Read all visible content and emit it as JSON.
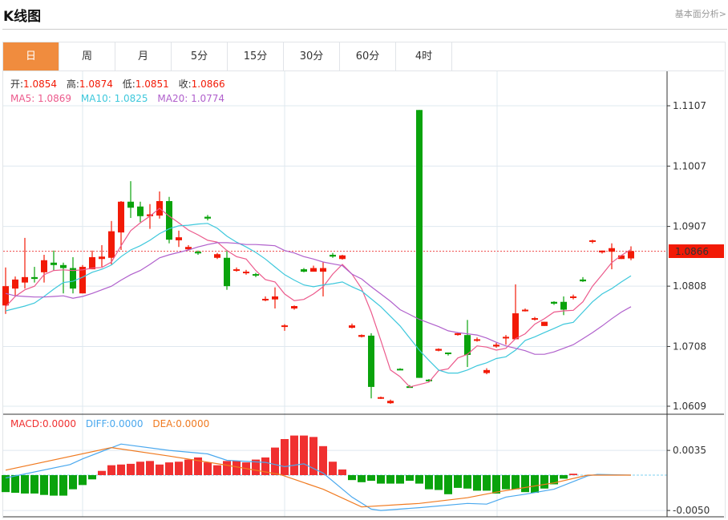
{
  "header": {
    "title": "K线图",
    "more_link": "基本面分析>"
  },
  "tabs": [
    {
      "label": "日",
      "active": true
    },
    {
      "label": "周"
    },
    {
      "label": "月"
    },
    {
      "label": "5分"
    },
    {
      "label": "15分"
    },
    {
      "label": "30分"
    },
    {
      "label": "60分"
    },
    {
      "label": "4时"
    }
  ],
  "colors": {
    "up": "#f21a06",
    "down": "#0aa30c",
    "ma5": "#ec5a8c",
    "ma10": "#3ec8dc",
    "ma20": "#b060cc",
    "macd": "#f03030",
    "diff": "#4aa8ee",
    "dea": "#f07a20",
    "accent": "#f08c3e"
  },
  "chart_data": [
    {
      "type": "candlestick",
      "ohlc_legend": {
        "open_label": "开:",
        "open": "1.0854",
        "high_label": "高:",
        "high": "1.0874",
        "low_label": "低:",
        "low": "1.0851",
        "close_label": "收:",
        "close": "1.0866"
      },
      "ma_legend": {
        "ma5": "MA5: 1.0869",
        "ma10": "MA10: 1.0825",
        "ma20": "MA20: 1.0774"
      },
      "current_price": "1.0866",
      "y_ticks": [
        "1.1107",
        "1.1007",
        "1.0907",
        "1.0808",
        "1.0708",
        "1.0609"
      ],
      "ylim": [
        1.0609,
        1.1107
      ],
      "ohlc": [
        [
          1.0776,
          1.0839,
          1.0762,
          1.0808
        ],
        [
          1.0804,
          1.0824,
          1.0791,
          1.0819
        ],
        [
          1.0814,
          1.0888,
          1.0804,
          1.0823
        ],
        [
          1.0823,
          1.084,
          1.0814,
          1.082
        ],
        [
          1.0831,
          1.086,
          1.0814,
          1.0851
        ],
        [
          1.0847,
          1.0867,
          1.0834,
          1.0843
        ],
        [
          1.0843,
          1.0847,
          1.0796,
          1.0838
        ],
        [
          1.0838,
          1.0856,
          1.0796,
          1.0804
        ],
        [
          1.0796,
          1.0843,
          1.0796,
          1.084
        ],
        [
          1.0836,
          1.0867,
          1.0836,
          1.0856
        ],
        [
          1.0853,
          1.0876,
          1.084,
          1.0857
        ],
        [
          1.0855,
          1.0916,
          1.0844,
          1.0899
        ],
        [
          1.0897,
          1.0949,
          1.0868,
          1.0948
        ],
        [
          1.0948,
          1.0982,
          1.0921,
          1.0938
        ],
        [
          1.094,
          1.0948,
          1.0914,
          1.0924
        ],
        [
          1.0924,
          1.0944,
          1.0903,
          1.0927
        ],
        [
          1.0925,
          1.0965,
          1.092,
          1.0949
        ],
        [
          1.0949,
          1.0956,
          1.0879,
          1.0885
        ],
        [
          1.0884,
          1.09,
          1.0873,
          1.0889
        ],
        [
          1.0869,
          1.0876,
          1.0867,
          1.0873
        ],
        [
          1.0865,
          1.0867,
          1.086,
          1.0863
        ],
        [
          1.0923,
          1.0926,
          1.0917,
          1.092
        ],
        [
          1.0855,
          1.0863,
          1.0853,
          1.0861
        ],
        [
          1.0855,
          1.0868,
          1.0802,
          1.0808
        ],
        [
          1.0835,
          1.0839,
          1.0832,
          1.0836
        ],
        [
          1.083,
          1.0835,
          1.0827,
          1.0832
        ],
        [
          1.0828,
          1.083,
          1.0823,
          1.0827
        ],
        [
          1.0786,
          1.0791,
          1.0783,
          1.0787
        ],
        [
          1.0786,
          1.0806,
          1.0771,
          1.0791
        ],
        [
          1.0742,
          1.0745,
          1.0734,
          1.0743
        ],
        [
          1.0771,
          1.0776,
          1.0769,
          1.0775
        ],
        [
          1.0836,
          1.0838,
          1.0831,
          1.0832
        ],
        [
          1.0832,
          1.0842,
          1.0832,
          1.0838
        ],
        [
          1.0832,
          1.0848,
          1.0791,
          1.0838
        ],
        [
          1.086,
          1.0863,
          1.0855,
          1.0857
        ],
        [
          1.0853,
          1.086,
          1.0852,
          1.0859
        ],
        [
          1.0739,
          1.0746,
          1.0738,
          1.0743
        ],
        [
          1.0724,
          1.0728,
          1.0723,
          1.0727
        ],
        [
          1.0726,
          1.073,
          1.0622,
          1.0641
        ],
        [
          1.0622,
          1.0625,
          1.0621,
          1.0624
        ],
        [
          1.0614,
          1.062,
          1.0613,
          1.0618
        ],
        [
          1.0671,
          1.0672,
          1.0669,
          1.067
        ],
        [
          1.0642,
          1.0644,
          1.064,
          1.0641
        ],
        [
          1.11,
          1.11,
          1.0656,
          1.0656
        ],
        [
          1.0653,
          1.0654,
          1.0649,
          1.0651
        ],
        [
          1.0701,
          1.0705,
          1.07,
          1.0704
        ],
        [
          1.0698,
          1.0698,
          1.0693,
          1.0696
        ],
        [
          1.0727,
          1.0731,
          1.0726,
          1.073
        ],
        [
          1.0727,
          1.0752,
          1.0674,
          1.0694
        ],
        [
          1.0718,
          1.0723,
          1.0716,
          1.072
        ],
        [
          1.0664,
          1.0672,
          1.0662,
          1.0669
        ],
        [
          1.0708,
          1.0714,
          1.0706,
          1.0711
        ],
        [
          1.0722,
          1.0727,
          1.0711,
          1.0724
        ],
        [
          1.072,
          1.0811,
          1.072,
          1.0763
        ],
        [
          1.0767,
          1.0771,
          1.0766,
          1.0769
        ],
        [
          1.0753,
          1.0757,
          1.0751,
          1.0755
        ],
        [
          1.0742,
          1.0749,
          1.0742,
          1.0749
        ],
        [
          1.0782,
          1.0783,
          1.0777,
          1.0779
        ],
        [
          1.0782,
          1.0791,
          1.076,
          1.0769
        ],
        [
          1.079,
          1.0794,
          1.0786,
          1.0791
        ],
        [
          1.0819,
          1.0823,
          1.0815,
          1.0816
        ],
        [
          1.0883,
          1.0885,
          1.0879,
          1.0884
        ],
        [
          1.0864,
          1.0867,
          1.0862,
          1.0867
        ],
        [
          1.0865,
          1.0879,
          1.0836,
          1.0871
        ],
        [
          1.0853,
          1.0859,
          1.0853,
          1.0859
        ],
        [
          1.0854,
          1.0874,
          1.0851,
          1.0866
        ]
      ],
      "ma5": [
        1.0774,
        1.0791,
        1.0802,
        1.0808,
        1.0827,
        1.0834,
        1.0835,
        1.0834,
        1.0835,
        1.0838,
        1.0839,
        1.0848,
        1.0875,
        1.09,
        1.0913,
        1.0924,
        1.0937,
        1.0924,
        1.0913,
        1.0901,
        1.0893,
        1.0884,
        1.0881,
        1.0867,
        1.0857,
        1.0853,
        1.0834,
        1.0819,
        1.0815,
        1.0795,
        1.0784,
        1.0786,
        1.0795,
        1.0807,
        1.0828,
        1.0844,
        1.0828,
        1.0804,
        1.0765,
        1.0718,
        1.0669,
        1.0658,
        1.0641,
        1.0645,
        1.0649,
        1.0668,
        1.0671,
        1.0689,
        1.0695,
        1.0709,
        1.0707,
        1.0702,
        1.0705,
        1.0721,
        1.0729,
        1.0745,
        1.0754,
        1.0765,
        1.0767,
        1.0768,
        1.0782,
        1.0808,
        1.0827,
        1.0847,
        1.0859,
        1.0869
      ],
      "ma10": [
        1.0767,
        1.0771,
        1.0775,
        1.078,
        1.0791,
        1.0803,
        1.0814,
        1.0816,
        1.0823,
        1.0831,
        1.0836,
        1.0843,
        1.0857,
        1.0868,
        1.0875,
        1.0884,
        1.0895,
        1.0903,
        1.0908,
        1.0909,
        1.0911,
        1.0912,
        1.0904,
        1.0891,
        1.0881,
        1.0873,
        1.0864,
        1.0853,
        1.084,
        1.0827,
        1.0818,
        1.081,
        1.0807,
        1.081,
        1.0812,
        1.0815,
        1.0807,
        1.08,
        1.0787,
        1.0774,
        1.0758,
        1.0742,
        1.0722,
        1.0702,
        1.0685,
        1.0669,
        1.0664,
        1.0664,
        1.0669,
        1.0676,
        1.0681,
        1.0688,
        1.0691,
        1.0702,
        1.0718,
        1.0724,
        1.0731,
        1.0738,
        1.0745,
        1.0748,
        1.0765,
        1.0782,
        1.0795,
        1.0804,
        1.0815,
        1.0825
      ],
      "ma20": [
        1.0796,
        1.0792,
        1.0791,
        1.079,
        1.079,
        1.0791,
        1.0792,
        1.0788,
        1.0791,
        1.0796,
        1.0802,
        1.0808,
        1.0818,
        1.0827,
        1.0834,
        1.0844,
        1.0855,
        1.086,
        1.0864,
        1.0868,
        1.0873,
        1.0877,
        1.088,
        1.088,
        1.0879,
        1.0877,
        1.0877,
        1.0876,
        1.0875,
        1.0867,
        1.0863,
        1.0857,
        1.0853,
        1.0848,
        1.0845,
        1.0842,
        1.0828,
        1.082,
        1.0807,
        1.0795,
        1.0783,
        1.0769,
        1.0761,
        1.0753,
        1.0747,
        1.0741,
        1.0734,
        1.0731,
        1.0729,
        1.0727,
        1.0722,
        1.0715,
        1.0709,
        1.0705,
        1.0701,
        1.0695,
        1.0695,
        1.0699,
        1.0705,
        1.0711,
        1.0721,
        1.0731,
        1.0742,
        1.0754,
        1.0765,
        1.0774
      ]
    },
    {
      "type": "bar+line",
      "legend": {
        "macd": "MACD:0.0000",
        "diff": "DIFF:0.0000",
        "dea": "DEA:0.0000"
      },
      "y_ticks": [
        "0.0035",
        "-0.0050"
      ],
      "ylim": [
        -0.0052,
        0.006
      ],
      "macd": [
        -0.0024,
        -0.0025,
        -0.0026,
        -0.0026,
        -0.0028,
        -0.0029,
        -0.0029,
        -0.002,
        -0.0014,
        -0.0006,
        0.0006,
        0.0014,
        0.0015,
        0.0016,
        0.0019,
        0.002,
        0.0015,
        0.0018,
        0.0019,
        0.0022,
        0.0025,
        0.0018,
        0.0014,
        0.002,
        0.002,
        0.0018,
        0.0022,
        0.0025,
        0.0039,
        0.0051,
        0.0056,
        0.0056,
        0.0054,
        0.0041,
        0.0019,
        0.0008,
        -0.0007,
        -0.001,
        -0.0008,
        -0.0012,
        -0.0012,
        -0.0012,
        -0.0008,
        -0.0012,
        -0.002,
        -0.0021,
        -0.0027,
        -0.0018,
        -0.0019,
        -0.0022,
        -0.0022,
        -0.0026,
        -0.002,
        -0.002,
        -0.0024,
        -0.0025,
        -0.0019,
        -0.0013,
        -0.0005,
        0.0002,
        0,
        0,
        0,
        0,
        0,
        0
      ],
      "diff": [
        [
          0,
          -0.0004
        ],
        [
          6.7,
          0.0015
        ],
        [
          8,
          0.0023
        ],
        [
          12,
          0.0044
        ],
        [
          17,
          0.0035
        ],
        [
          21,
          0.003
        ],
        [
          23,
          0.0021
        ],
        [
          27,
          0.0018
        ],
        [
          29,
          0.0012
        ],
        [
          31,
          0.0016
        ],
        [
          33,
          0.0003
        ],
        [
          36,
          -0.0031
        ],
        [
          38,
          -0.0048
        ],
        [
          39,
          -0.005
        ],
        [
          43,
          -0.0046
        ],
        [
          48,
          -0.004
        ],
        [
          50,
          -0.0041
        ],
        [
          52,
          -0.0031
        ],
        [
          54,
          -0.0027
        ],
        [
          57,
          -0.002
        ],
        [
          60.5,
          -0.0001
        ],
        [
          61.5,
          0.0001
        ],
        [
          65,
          0
        ]
      ],
      "dea": [
        [
          0,
          0.0007
        ],
        [
          11,
          0.0039
        ],
        [
          17,
          0.0027
        ],
        [
          23,
          0.0014
        ],
        [
          28.5,
          0.0001
        ],
        [
          33,
          -0.002
        ],
        [
          37,
          -0.0045
        ],
        [
          43,
          -0.004
        ],
        [
          48,
          -0.0032
        ],
        [
          51,
          -0.0024
        ],
        [
          57,
          -0.0011
        ],
        [
          60.5,
          0
        ],
        [
          65,
          0
        ]
      ]
    }
  ]
}
